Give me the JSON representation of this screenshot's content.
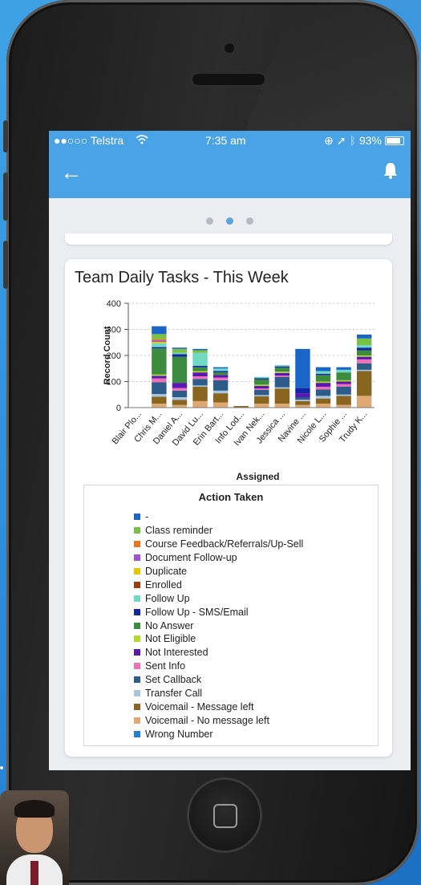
{
  "status_bar": {
    "carrier": "●●○○○ Telstra",
    "time": "7:35 am",
    "battery": "93%",
    "battery_level": 0.93
  },
  "nav": {
    "back_icon": "arrow-left-icon",
    "bell_icon": "bell-icon"
  },
  "pager": {
    "count": 3,
    "active_index": 1
  },
  "card": {
    "title": "Team Daily Tasks - This Week"
  },
  "chart_data": {
    "type": "bar",
    "stacked": true,
    "xlabel": "Assigned",
    "ylabel": "Record Count",
    "ylim": [
      0,
      400
    ],
    "yticks": [
      0,
      100,
      200,
      300,
      400
    ],
    "grid": "horizontal dotted",
    "categories": [
      "Blair Plo...",
      "Chris M...",
      "Daniel A...",
      "David Lu...",
      "Erin Bart...",
      "Info Lod...",
      "Ivan Nek...",
      "Jessica ...",
      "Navine ...",
      "Nicole L...",
      "Sophie ...",
      "Trudy K..."
    ],
    "totals": [
      0,
      317,
      230,
      225,
      155,
      6,
      118,
      163,
      225,
      155,
      155,
      280
    ],
    "series": [
      {
        "name": "-",
        "color": "#1a66c8",
        "values": [
          0,
          30,
          5,
          5,
          5,
          0,
          0,
          0,
          150,
          15,
          10,
          15
        ]
      },
      {
        "name": "Class reminder",
        "color": "#7ac143",
        "values": [
          0,
          20,
          15,
          10,
          0,
          0,
          0,
          0,
          0,
          0,
          0,
          25
        ]
      },
      {
        "name": "Course Feedback/Referrals/Up-Sell",
        "color": "#e87722",
        "values": [
          0,
          5,
          0,
          0,
          0,
          0,
          0,
          0,
          0,
          0,
          0,
          0
        ]
      },
      {
        "name": "Document Follow-up",
        "color": "#a34fd6",
        "values": [
          0,
          5,
          0,
          0,
          0,
          0,
          0,
          0,
          0,
          0,
          0,
          0
        ]
      },
      {
        "name": "Duplicate",
        "color": "#e6c700",
        "values": [
          0,
          5,
          0,
          0,
          0,
          0,
          0,
          0,
          0,
          0,
          0,
          0
        ]
      },
      {
        "name": "Enrolled",
        "color": "#a03c0a",
        "values": [
          0,
          0,
          0,
          0,
          0,
          0,
          0,
          0,
          0,
          0,
          0,
          0
        ]
      },
      {
        "name": "Follow Up",
        "color": "#6fd9c4",
        "values": [
          0,
          15,
          5,
          50,
          10,
          0,
          5,
          5,
          0,
          10,
          10,
          10
        ]
      },
      {
        "name": "Follow Up - SMS/Email",
        "color": "#1425a8",
        "values": [
          0,
          5,
          10,
          5,
          5,
          0,
          5,
          5,
          20,
          5,
          0,
          10
        ]
      },
      {
        "name": "No Answer",
        "color": "#3c8c3f",
        "values": [
          0,
          100,
          100,
          15,
          10,
          0,
          20,
          15,
          0,
          25,
          30,
          20
        ]
      },
      {
        "name": "Not Eligible",
        "color": "#b5d92b",
        "values": [
          0,
          5,
          0,
          5,
          0,
          0,
          5,
          5,
          0,
          5,
          5,
          5
        ]
      },
      {
        "name": "Not Interested",
        "color": "#5a17b3",
        "values": [
          0,
          10,
          20,
          15,
          10,
          0,
          10,
          10,
          15,
          15,
          10,
          10
        ]
      },
      {
        "name": "Sent Info",
        "color": "#f070b8",
        "values": [
          0,
          15,
          10,
          10,
          10,
          0,
          5,
          5,
          0,
          10,
          10,
          15
        ]
      },
      {
        "name": "Set Callback",
        "color": "#2e5c8a",
        "values": [
          0,
          45,
          25,
          25,
          40,
          0,
          20,
          40,
          10,
          25,
          30,
          25
        ]
      },
      {
        "name": "Transfer Call",
        "color": "#a9c5e0",
        "values": [
          0,
          10,
          10,
          5,
          10,
          0,
          5,
          5,
          5,
          10,
          5,
          5
        ]
      },
      {
        "name": "Voicemail - Message left",
        "color": "#8a6520",
        "values": [
          0,
          27,
          20,
          55,
          35,
          6,
          28,
          58,
          15,
          20,
          35,
          95
        ]
      },
      {
        "name": "Voicemail - No message left",
        "color": "#e0a872",
        "values": [
          0,
          15,
          10,
          25,
          20,
          0,
          15,
          15,
          10,
          15,
          10,
          45
        ]
      },
      {
        "name": "Wrong Number",
        "color": "#1e7fd8",
        "values": [
          0,
          0,
          0,
          0,
          0,
          0,
          0,
          0,
          0,
          0,
          0,
          0
        ]
      }
    ]
  },
  "legend": {
    "title": "Action Taken",
    "items": [
      "-",
      "Class reminder",
      "Course Feedback/Referrals/Up-Sell",
      "Document Follow-up",
      "Duplicate",
      "Enrolled",
      "Follow Up",
      "Follow Up - SMS/Email",
      "No Answer",
      "Not Eligible",
      "Not Interested",
      "Sent Info",
      "Set Callback",
      "Transfer Call",
      "Voicemail - Message left",
      "Voicemail - No message left",
      "Wrong Number"
    ]
  }
}
